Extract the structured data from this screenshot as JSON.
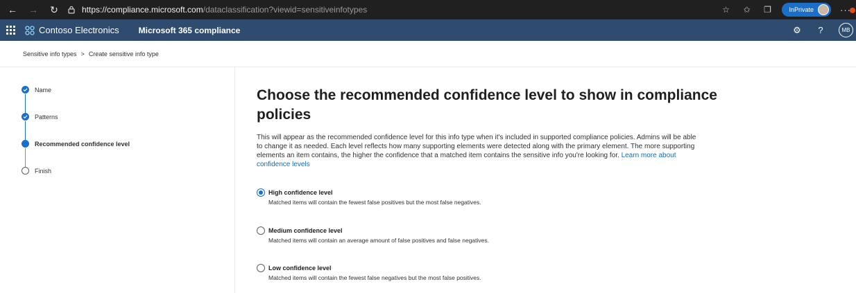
{
  "browser": {
    "url_host": "https://compliance.microsoft.com",
    "url_path": "/dataclassification?viewid=sensitiveinfotypes",
    "inprivate_label": "InPrivate",
    "icons": [
      "back-arrow",
      "forward-arrow",
      "refresh",
      "lock",
      "favorites-add",
      "favorites",
      "collections",
      "more"
    ]
  },
  "header": {
    "org_name": "Contoso Electronics",
    "app_name": "Microsoft 365 compliance",
    "avatar_initials": "MB",
    "color": "#2f4b6e"
  },
  "breadcrumb": {
    "items": [
      "Sensitive info types",
      "Create sensitive info type"
    ],
    "separator": ">"
  },
  "stepper": {
    "steps": [
      {
        "label": "Name",
        "state": "done"
      },
      {
        "label": "Patterns",
        "state": "done"
      },
      {
        "label": "Recommended confidence level",
        "state": "current"
      },
      {
        "label": "Finish",
        "state": "todo"
      }
    ]
  },
  "main": {
    "title": "Choose the recommended confidence level to show in compliance policies",
    "description": "This will appear as the recommended confidence level for this info type when it's included in supported compliance policies. Admins will be able to change it as needed. Each level reflects how many supporting elements were detected along with the primary element. The more supporting elements an item contains, the higher the confidence that a matched item contains the sensitive info you're looking for.",
    "learn_more_link": "Learn more about confidence levels",
    "options": [
      {
        "label": "High confidence level",
        "description": "Matched items will contain the fewest false positives but the most false negatives.",
        "checked": true
      },
      {
        "label": "Medium confidence level",
        "description": "Matched items will contain an average amount of false positives and false negatives.",
        "checked": false
      },
      {
        "label": "Low confidence level",
        "description": "Matched items will contain the fewest false negatives but the most false positives.",
        "checked": false
      }
    ]
  },
  "colors": {
    "accent": "#1a6fc9",
    "link": "#0f6cbd"
  }
}
